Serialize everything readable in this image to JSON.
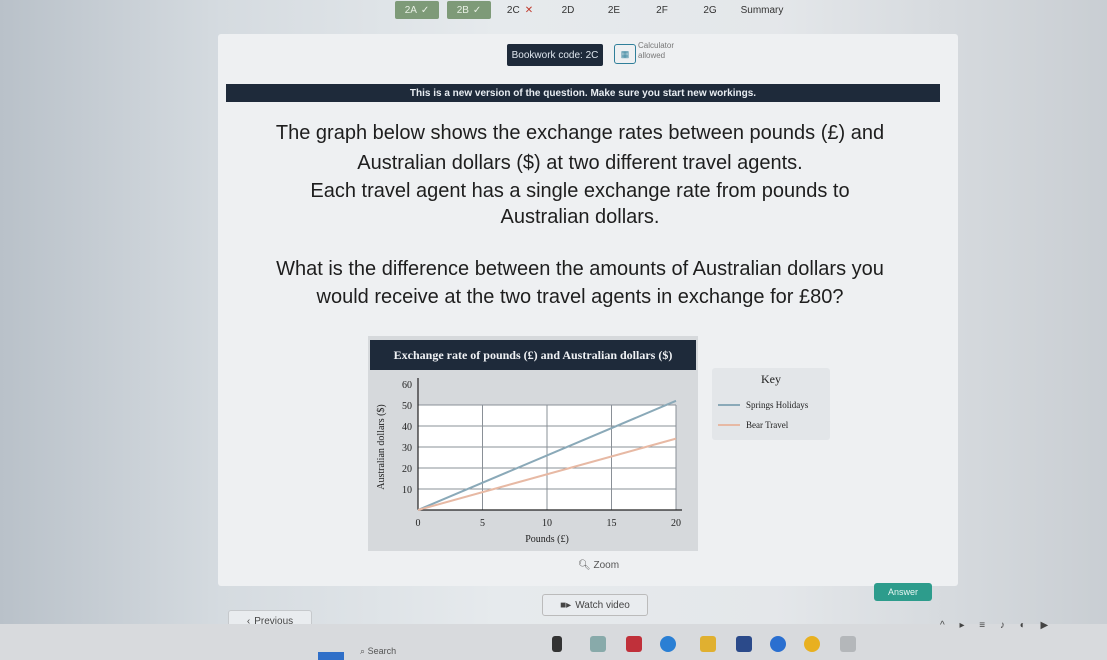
{
  "tabs": [
    {
      "label": "2A",
      "state": "done",
      "mark": "✓"
    },
    {
      "label": "2B",
      "state": "done",
      "mark": "✓"
    },
    {
      "label": "2C",
      "state": "wrong",
      "mark": "✕"
    },
    {
      "label": "2D"
    },
    {
      "label": "2E"
    },
    {
      "label": "2F"
    },
    {
      "label": "2G"
    },
    {
      "label": "Summary"
    }
  ],
  "header": {
    "bookwork": "Bookwork code: 2C",
    "calculator": "Calculator allowed"
  },
  "notice": "This is a new version of the question. Make sure you start new workings.",
  "question": {
    "line1": "The graph below shows the exchange rates between pounds (£) and",
    "line2": "Australian dollars ($) at two different travel agents.",
    "line3": "Each travel agent has a single exchange rate from pounds to",
    "line4": "Australian dollars.",
    "line5": "What is the difference between the amounts of Australian dollars you",
    "line6": "would receive at the two travel agents in exchange for £80?"
  },
  "chart_data": {
    "type": "line",
    "title": "Exchange rate of pounds (£) and Australian dollars ($)",
    "xlabel": "Pounds (£)",
    "ylabel": "Australian dollars ($)",
    "xlim": [
      0,
      20
    ],
    "ylim": [
      0,
      60
    ],
    "xticks": [
      0,
      5,
      10,
      15,
      20
    ],
    "yticks": [
      10,
      20,
      30,
      40,
      50,
      60
    ],
    "grid": true,
    "series": [
      {
        "name": "Springs Holidays",
        "color": "#8aa9b8",
        "x": [
          0,
          20
        ],
        "y": [
          0,
          52
        ]
      },
      {
        "name": "Bear Travel",
        "color": "#e7b9a4",
        "x": [
          0,
          20
        ],
        "y": [
          0,
          34
        ]
      }
    ]
  },
  "key": {
    "title": "Key"
  },
  "controls": {
    "zoom": "Zoom",
    "answer": "Answer",
    "watch_video": "Watch video",
    "previous": "Previous"
  },
  "taskbar": {
    "search": "Search"
  }
}
